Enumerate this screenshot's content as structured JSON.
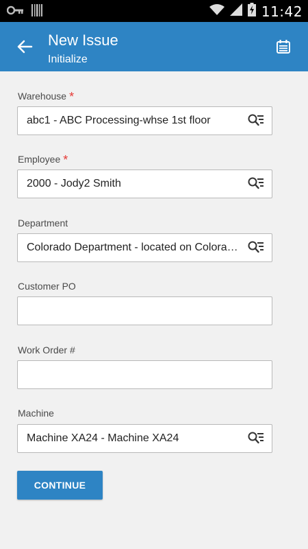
{
  "status_bar": {
    "time": "11:42",
    "icons": [
      "key-icon",
      "barcode-icon",
      "wifi-icon",
      "signal-icon",
      "battery-charging-icon"
    ]
  },
  "header": {
    "title": "New Issue",
    "subtitle": "Initialize",
    "back_icon": "arrow-left-icon",
    "calendar_icon": "calendar-icon",
    "background": "#2e84c4"
  },
  "form": {
    "fields": [
      {
        "label": "Warehouse",
        "required": true,
        "value": "abc1 - ABC Processing-whse 1st floor",
        "lookup": true
      },
      {
        "label": "Employee",
        "required": true,
        "value": "2000 - Jody2 Smith",
        "lookup": true
      },
      {
        "label": "Department",
        "required": false,
        "value": "Colorado Department - located on Colorado Street",
        "lookup": true
      },
      {
        "label": "Customer PO",
        "required": false,
        "value": "",
        "lookup": false
      },
      {
        "label": "Work Order #",
        "required": false,
        "value": "",
        "lookup": false
      },
      {
        "label": "Machine",
        "required": false,
        "value": "Machine XA24 - Machine XA24",
        "lookup": true
      }
    ],
    "required_marker": "*",
    "continue_label": "CONTINUE"
  },
  "colors": {
    "accent": "#2e84c4",
    "required": "#e53935",
    "background": "#f1f1f1"
  }
}
